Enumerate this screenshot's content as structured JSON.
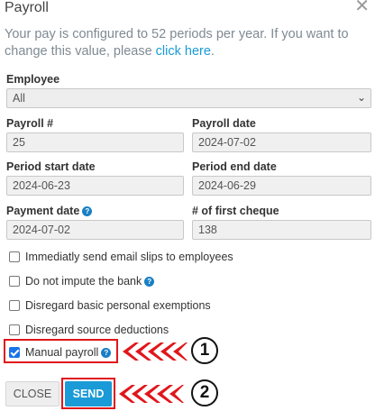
{
  "dialog": {
    "title": "Payroll",
    "close_glyph": "✕",
    "info_text": "Your pay is configured to 52 periods per year. If you want to change this value, please ",
    "info_link": "click here",
    "info_end": "."
  },
  "employee": {
    "label": "Employee",
    "value": "All"
  },
  "payroll_number": {
    "label": "Payroll #",
    "value": "25"
  },
  "payroll_date": {
    "label": "Payroll date",
    "value": "2024-07-02"
  },
  "period_start": {
    "label": "Period start date",
    "value": "2024-06-23"
  },
  "period_end": {
    "label": "Period end date",
    "value": "2024-06-29"
  },
  "payment_date": {
    "label": "Payment date",
    "value": "2024-07-02"
  },
  "first_cheque": {
    "label": "# of first cheque",
    "value": "138"
  },
  "checkboxes": [
    {
      "label": "Immediatly send email slips to employees",
      "checked": false
    },
    {
      "label": "Do not impute the bank",
      "checked": false,
      "help": true
    },
    {
      "label": "Disregard basic personal exemptions",
      "checked": false
    },
    {
      "label": "Disregard source deductions",
      "checked": false
    },
    {
      "label": "Manual payroll",
      "checked": true,
      "help": true
    }
  ],
  "buttons": {
    "close": "CLOSE",
    "send": "SEND"
  },
  "annotations": {
    "step1": "1",
    "step2": "2",
    "color": "#e0161b"
  },
  "colors": {
    "accent": "#1a9ad6",
    "help_icon": "#1a7fc4"
  }
}
